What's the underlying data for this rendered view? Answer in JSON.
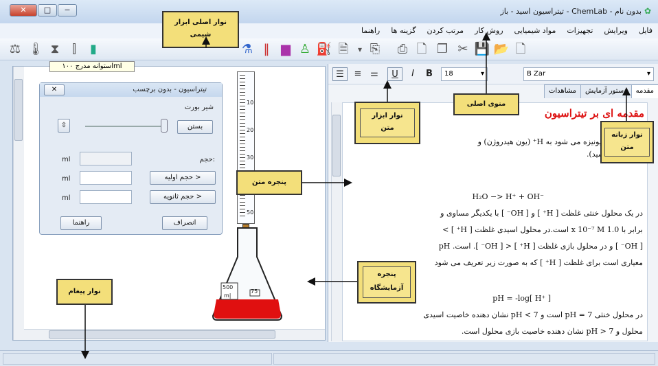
{
  "window": {
    "title": "بدون نام - ChemLab - تیتراسیون اسید - باز",
    "controls": {
      "minimize": "−",
      "maximize": "□",
      "close": "✕"
    }
  },
  "menu": [
    "فایل",
    "ویرایش",
    "تجهیزات",
    "مواد شیمیایی",
    "روش کار",
    "مرتب کردن",
    "گزینه ها",
    "راهنما"
  ],
  "toolbar": {
    "icons": [
      "balance-icon",
      "thermometer-icon",
      "hourglass-icon",
      "stand-icon",
      "cylinder-icon",
      "beaker-icon",
      "flask-icon",
      "test-tubes-icon",
      "bottle-icon",
      "person-icon",
      "spray-icon",
      "document-icon",
      "dropdown-icon",
      "clip-icon",
      "print-icon",
      "preview-icon",
      "copy-icon",
      "cut-icon",
      "save-icon",
      "open-icon",
      "new-icon"
    ],
    "tooltip": "استوانه مدرج ۱۰۰ml"
  },
  "dialog": {
    "title": "تیتراسیون - بدون برچسب",
    "close_label": "✕",
    "valve_label": "شیر بورت",
    "close_button": "بستن",
    "volume_label": "حجم:",
    "unit": "ml",
    "initial_volume_button": "حجم اولیه >",
    "secondary_volume_button": "حجم ثانویه >",
    "cancel_button": "انصراف",
    "help_button": "راهنما"
  },
  "burette": {
    "ticks": [
      "10",
      "20",
      "30",
      "40",
      "50"
    ]
  },
  "flask": {
    "volume_mark": "75",
    "label_top": "500",
    "label_bottom": "m|",
    "fill_color": "#e01010"
  },
  "editor": {
    "format": {
      "font_size": "18",
      "font_name": "B Zar",
      "bold": "B",
      "italic": "I",
      "underline": "U"
    },
    "tabs": [
      "مقدمه",
      "دستور آزمایش",
      "مشاهدات"
    ],
    "heading": "مقدمه ای بر تیتراسیون",
    "lines": [
      "آب حاصل از یونیزه می شود به H⁺ (یون هیدروژن) و",
      "(یون هیدروکسید).",
      "H₂O   −>   H⁺   +   OH⁻",
      "در یک محلول خنثی غلظت [ H⁺ ] و [ OH⁻ ] با یکدیگر مساوی و",
      "برابر با 1.0 x 10⁻⁷ M است.در محلول اسیدی غلظت [ H⁺ ] >",
      "[ OH⁻ ] و در محلول بازی غلظت [ H⁺ ] < [ OH⁻ ]. است. pH",
      "معیاری است برای غلظت [ H⁺ ] که به صورت زیر تعریف می شود",
      "pH = -log[ H⁺ ]",
      "در محلول خنثی pH = 7 است و pH < 7 نشان دهنده خاصیت اسیدی",
      "محلول و pH > 7 نشان دهنده خاصیت بازی محلول است."
    ]
  },
  "callouts": {
    "main_toolbar": "نوار اصلی ابزار شیمی",
    "text_toolbar": "نوار ابزار متن",
    "main_menu": "منوی اصلی",
    "text_tabs": "نوار زبانه متن",
    "text_window": "پنجره متن",
    "lab_window": "پنجره آزمایشگاه",
    "message_bar": "نوار پیغام"
  },
  "colors": {
    "accent": "#d11111",
    "callout": "#f3df7a",
    "window": "#d9e4f1"
  }
}
